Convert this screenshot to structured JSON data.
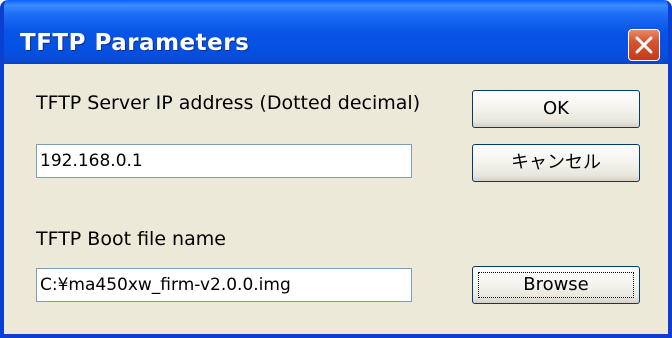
{
  "dialog": {
    "title": "TFTP Parameters",
    "title_icon": "close-icon",
    "accent": "#0a3fd0",
    "server_ip_label": "TFTP Server IP address (Dotted decimal)",
    "server_ip_value": "192.168.0.1",
    "boot_file_label": "TFTP Boot file name",
    "boot_file_value": "C:¥ma450xw_firm-v2.0.0.img",
    "ok_label": "OK",
    "cancel_label": "キャンセル",
    "browse_label": "Browse"
  }
}
